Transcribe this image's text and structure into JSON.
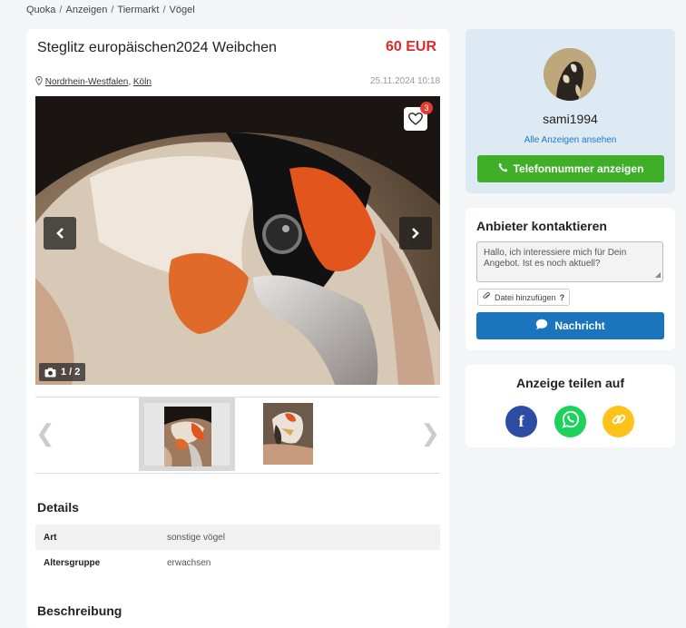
{
  "breadcrumb": [
    "Quoka",
    "Anzeigen",
    "Tiermarkt",
    "Vögel"
  ],
  "breadcrumb_separator": "/",
  "ad": {
    "title": "Steglitz europäischen2024 Weibchen",
    "price": "60 EUR",
    "location_region": "Nordrhein-Westfalen",
    "location_city": "Köln",
    "location_separator": ",",
    "date": "25.11.2024 10:18",
    "favorite_count": "3",
    "photo_counter": "1 / 2"
  },
  "details": {
    "title": "Details",
    "rows": [
      {
        "key": "Art",
        "value": "sonstige vögel"
      },
      {
        "key": "Altersgruppe",
        "value": "erwachsen"
      }
    ]
  },
  "description": {
    "title": "Beschreibung"
  },
  "seller": {
    "name": "sami1994",
    "all_ads_label": "Alle Anzeigen ansehen",
    "phone_button_label": "Telefonnummer anzeigen"
  },
  "contact": {
    "title": "Anbieter kontaktieren",
    "message_text": "Hallo, ich interessiere mich für Dein Angebot. Ist es noch aktuell?",
    "attach_label": "Datei hinzufügen",
    "attach_help": "?",
    "send_label": "Nachricht"
  },
  "share": {
    "title": "Anzeige teilen auf",
    "facebook_glyph": "f"
  },
  "colors": {
    "price": "#e02a2a",
    "phone_button": "#3fae29",
    "message_button": "#1b75bc",
    "link": "#1e7ac7",
    "facebook": "#2c4da3",
    "whatsapp": "#1bd25b",
    "copy_link": "#ffc21a"
  }
}
